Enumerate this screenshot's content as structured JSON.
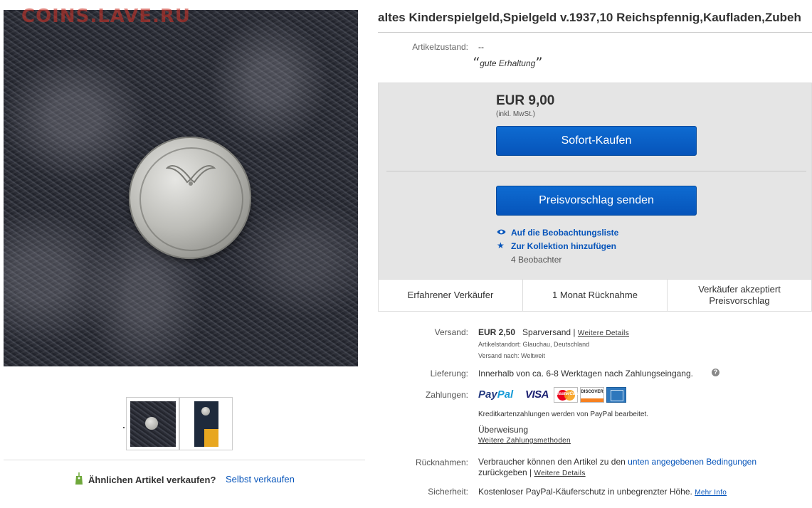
{
  "watermark": "COINS.LAVE.RU",
  "listing": {
    "title": "altes Kinderspielgeld,Spielgeld v.1937,10 Reichspfennig,Kaufladen,Zubeh",
    "condition_label": "Artikelzustand:",
    "condition_value": "--",
    "condition_quote": "gute Erhaltung"
  },
  "buybox": {
    "price": "EUR 9,00",
    "vat": "(inkl. MwSt.)",
    "buy_label": "Sofort-Kaufen",
    "offer_label": "Preisvorschlag senden",
    "watch_label": "Auf die Beobachtungsliste",
    "collection_label": "Zur Kollektion hinzufügen",
    "watchers": "4 Beobachter"
  },
  "badges": [
    "Erfahrener Verkäufer",
    "1 Monat Rücknahme",
    "Verkäufer akzeptiert Preisvorschlag"
  ],
  "shipping": {
    "label": "Versand:",
    "cost": "EUR 2,50",
    "method": "Sparversand |",
    "more": "Weitere Details",
    "location": "Artikelstandort: Glauchau, Deutschland",
    "ships_to": "Versand nach: Weltweit"
  },
  "delivery": {
    "label": "Lieferung:",
    "value": "Innerhalb von ca. 6-8 Werktagen nach Zahlungseingang.",
    "help": "?"
  },
  "payments": {
    "label": "Zahlungen:",
    "paypal_a": "Pay",
    "paypal_b": "Pal",
    "visa": "VISA",
    "mastercard": "MasterCard",
    "discover": "DISCOVER",
    "note": "Kreditkartenzahlungen werden von PayPal bearbeitet.",
    "transfer": "Überweisung",
    "more": "Weitere Zahlungsmethoden"
  },
  "returns": {
    "label": "Rücknahmen:",
    "text_a": "Verbraucher können den Artikel zu den",
    "link": "unten angegebenen Bedingungen",
    "text_b": "zurückgeben |",
    "more": "Weitere Details"
  },
  "security": {
    "label": "Sicherheit:",
    "text": "Kostenloser PayPal-Käuferschutz in unbegrenzter Höhe.",
    "more": "Mehr Info"
  },
  "sell": {
    "question": "Ähnlichen Artikel verkaufen?",
    "link": "Selbst verkaufen"
  },
  "colors": {
    "accent": "#0654ba",
    "buybox_bg": "#e5e5e5"
  }
}
